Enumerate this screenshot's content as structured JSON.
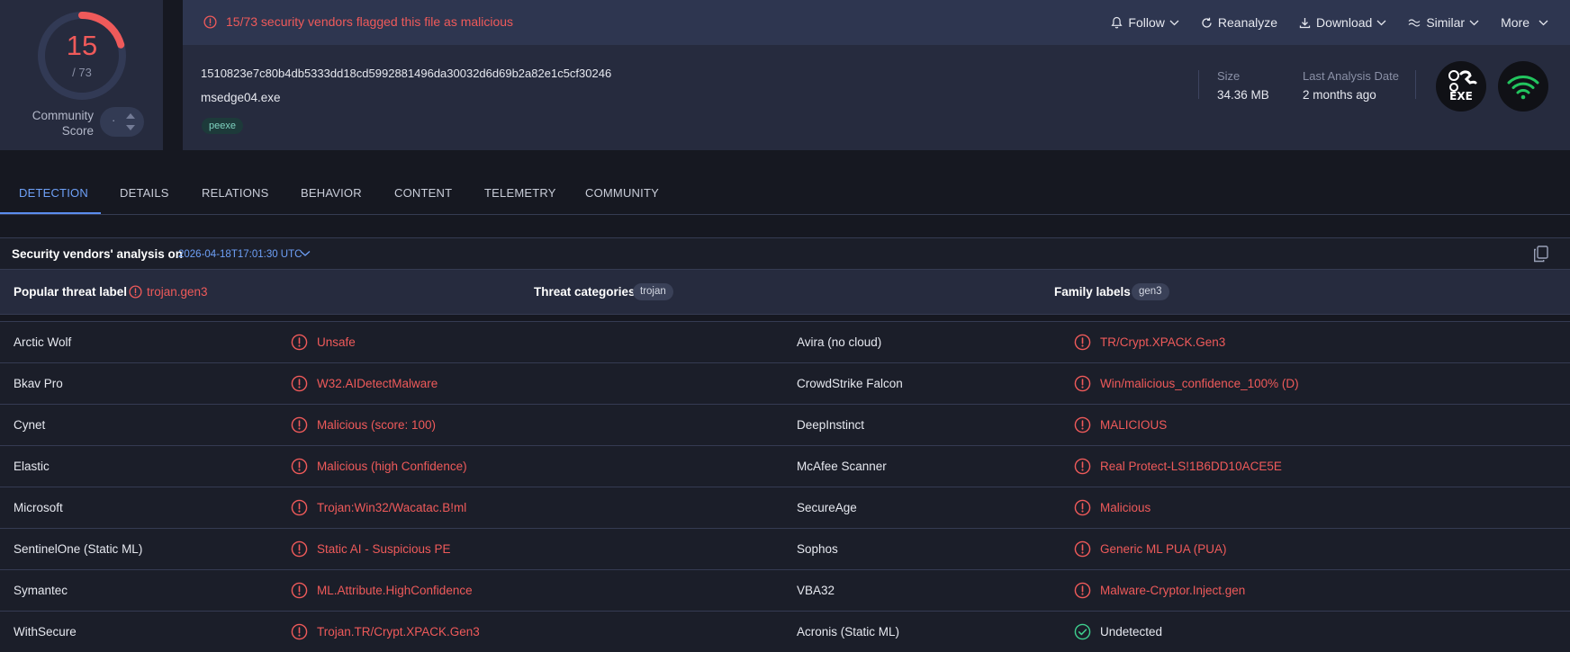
{
  "score": {
    "detections": "15",
    "total": "/ 73",
    "community_label_1": "Community",
    "community_label_2": "Score",
    "vote_value": "·"
  },
  "alert": {
    "text": "15/73 security vendors flagged this file as malicious"
  },
  "actions": [
    {
      "label": "Follow",
      "icon": "bell-icon"
    },
    {
      "label": "Reanalyze",
      "icon": "refresh-icon"
    },
    {
      "label": "Download",
      "icon": "download-icon"
    },
    {
      "label": "Similar",
      "icon": "similar-icon"
    },
    {
      "label": "More",
      "icon": ""
    }
  ],
  "file": {
    "hash": "1510823e7c80b4db5333dd18cd5992881496da30032d6d69b2a82e1c5cf30246",
    "name": "msedge04.exe",
    "tag": "peexe",
    "size_label": "Size",
    "size_value": "34.36 MB",
    "date_label": "Last Analysis Date",
    "date_value": "2 months ago",
    "badge_text": "EXE"
  },
  "tabs": [
    "DETECTION",
    "DETAILS",
    "RELATIONS",
    "BEHAVIOR",
    "CONTENT",
    "TELEMETRY",
    "COMMUNITY"
  ],
  "analysis": {
    "title": "Security vendors' analysis on",
    "date": "2026-04-18T17:01:30 UTC"
  },
  "threat": {
    "popular_label": "Popular threat label",
    "popular_value": "trojan.gen3",
    "categories_label": "Threat categories",
    "categories_value": "trojan",
    "family_label": "Family labels",
    "family_value": "gen3"
  },
  "vendors": [
    {
      "left_name": "Arctic Wolf",
      "left_result": "Unsafe",
      "left_status": "malicious",
      "right_name": "Avira (no cloud)",
      "right_result": "TR/Crypt.XPACK.Gen3",
      "right_status": "malicious"
    },
    {
      "left_name": "Bkav Pro",
      "left_result": "W32.AIDetectMalware",
      "left_status": "malicious",
      "right_name": "CrowdStrike Falcon",
      "right_result": "Win/malicious_confidence_100% (D)",
      "right_status": "malicious"
    },
    {
      "left_name": "Cynet",
      "left_result": "Malicious (score: 100)",
      "left_status": "malicious",
      "right_name": "DeepInstinct",
      "right_result": "MALICIOUS",
      "right_status": "malicious"
    },
    {
      "left_name": "Elastic",
      "left_result": "Malicious (high Confidence)",
      "left_status": "malicious",
      "right_name": "McAfee Scanner",
      "right_result": "Real Protect-LS!1B6DD10ACE5E",
      "right_status": "malicious"
    },
    {
      "left_name": "Microsoft",
      "left_result": "Trojan:Win32/Wacatac.B!ml",
      "left_status": "malicious",
      "right_name": "SecureAge",
      "right_result": "Malicious",
      "right_status": "malicious"
    },
    {
      "left_name": "SentinelOne (Static ML)",
      "left_result": "Static AI - Suspicious PE",
      "left_status": "malicious",
      "right_name": "Sophos",
      "right_result": "Generic ML PUA (PUA)",
      "right_status": "malicious"
    },
    {
      "left_name": "Symantec",
      "left_result": "ML.Attribute.HighConfidence",
      "left_status": "malicious",
      "right_name": "VBA32",
      "right_result": "Malware-Cryptor.Inject.gen",
      "right_status": "malicious"
    },
    {
      "left_name": "WithSecure",
      "left_result": "Trojan.TR/Crypt.XPACK.Gen3",
      "left_status": "malicious",
      "right_name": "Acronis (Static ML)",
      "right_result": "Undetected",
      "right_status": "undetected"
    }
  ],
  "colors": {
    "malicious": "#ef5a5a",
    "undetected": "#3ecf8e",
    "accent": "#6ea0f7"
  },
  "detection_ratio": 0.2055
}
